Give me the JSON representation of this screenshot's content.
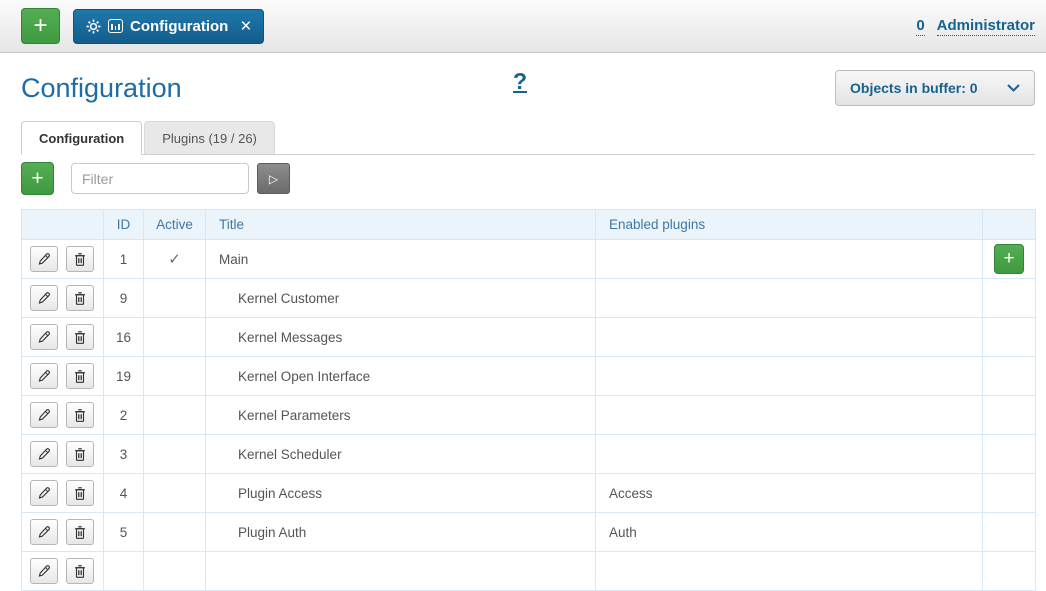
{
  "topbar": {
    "add_label": "+",
    "open_tab": {
      "label": "Configuration",
      "close_label": "×"
    },
    "user": {
      "count": "0",
      "name": "Administrator"
    }
  },
  "page": {
    "title": "Configuration",
    "help_label": "?",
    "buffer_button_label": "Objects in buffer: 0"
  },
  "tabs": [
    {
      "label": "Configuration",
      "active": true
    },
    {
      "label": "Plugins (19 / 26)",
      "active": false
    }
  ],
  "filter": {
    "add_label": "+",
    "placeholder": "Filter",
    "value": "",
    "run_label": "▷"
  },
  "table": {
    "columns": [
      "",
      "ID",
      "Active",
      "Title",
      "Enabled plugins",
      ""
    ],
    "rows": [
      {
        "id": "1",
        "active": "✓",
        "title": "Main",
        "plugins": "",
        "indent": false,
        "has_add": true
      },
      {
        "id": "9",
        "active": "",
        "title": "Kernel Customer",
        "plugins": "",
        "indent": true,
        "has_add": false
      },
      {
        "id": "16",
        "active": "",
        "title": "Kernel Messages",
        "plugins": "",
        "indent": true,
        "has_add": false
      },
      {
        "id": "19",
        "active": "",
        "title": "Kernel Open Interface",
        "plugins": "",
        "indent": true,
        "has_add": false
      },
      {
        "id": "2",
        "active": "",
        "title": "Kernel Parameters",
        "plugins": "",
        "indent": true,
        "has_add": false
      },
      {
        "id": "3",
        "active": "",
        "title": "Kernel Scheduler",
        "plugins": "",
        "indent": true,
        "has_add": false
      },
      {
        "id": "4",
        "active": "",
        "title": "Plugin Access",
        "plugins": "Access",
        "indent": true,
        "has_add": false
      },
      {
        "id": "5",
        "active": "",
        "title": "Plugin Auth",
        "plugins": "Auth",
        "indent": true,
        "has_add": false
      }
    ]
  },
  "colors": {
    "accent_green": "#47a447",
    "accent_blue": "#17628f",
    "table_header_bg": "#ecf4fb",
    "table_border": "#d6e6f3"
  }
}
